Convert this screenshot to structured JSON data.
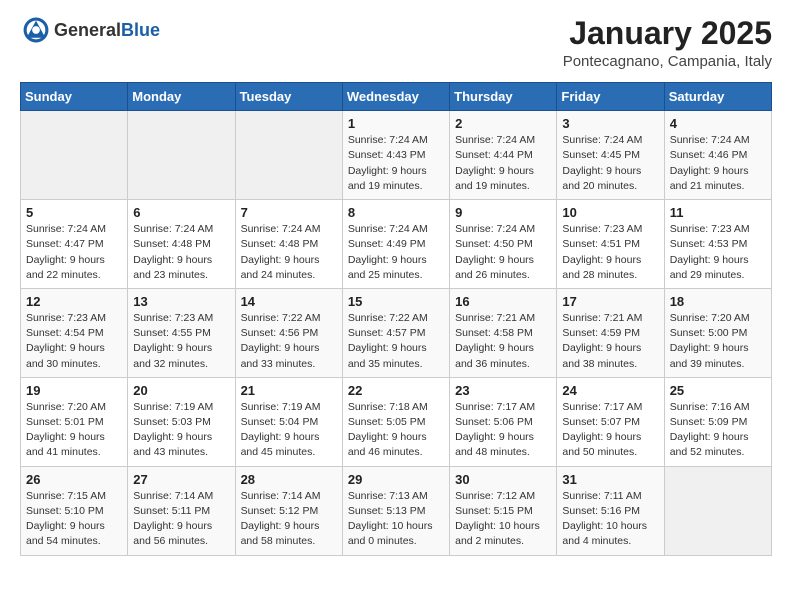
{
  "header": {
    "logo_general": "General",
    "logo_blue": "Blue",
    "month": "January 2025",
    "location": "Pontecagnano, Campania, Italy"
  },
  "weekdays": [
    "Sunday",
    "Monday",
    "Tuesday",
    "Wednesday",
    "Thursday",
    "Friday",
    "Saturday"
  ],
  "weeks": [
    [
      {
        "day": "",
        "sunrise": "",
        "sunset": "",
        "daylight": ""
      },
      {
        "day": "",
        "sunrise": "",
        "sunset": "",
        "daylight": ""
      },
      {
        "day": "",
        "sunrise": "",
        "sunset": "",
        "daylight": ""
      },
      {
        "day": "1",
        "sunrise": "Sunrise: 7:24 AM",
        "sunset": "Sunset: 4:43 PM",
        "daylight": "Daylight: 9 hours and 19 minutes."
      },
      {
        "day": "2",
        "sunrise": "Sunrise: 7:24 AM",
        "sunset": "Sunset: 4:44 PM",
        "daylight": "Daylight: 9 hours and 19 minutes."
      },
      {
        "day": "3",
        "sunrise": "Sunrise: 7:24 AM",
        "sunset": "Sunset: 4:45 PM",
        "daylight": "Daylight: 9 hours and 20 minutes."
      },
      {
        "day": "4",
        "sunrise": "Sunrise: 7:24 AM",
        "sunset": "Sunset: 4:46 PM",
        "daylight": "Daylight: 9 hours and 21 minutes."
      }
    ],
    [
      {
        "day": "5",
        "sunrise": "Sunrise: 7:24 AM",
        "sunset": "Sunset: 4:47 PM",
        "daylight": "Daylight: 9 hours and 22 minutes."
      },
      {
        "day": "6",
        "sunrise": "Sunrise: 7:24 AM",
        "sunset": "Sunset: 4:48 PM",
        "daylight": "Daylight: 9 hours and 23 minutes."
      },
      {
        "day": "7",
        "sunrise": "Sunrise: 7:24 AM",
        "sunset": "Sunset: 4:48 PM",
        "daylight": "Daylight: 9 hours and 24 minutes."
      },
      {
        "day": "8",
        "sunrise": "Sunrise: 7:24 AM",
        "sunset": "Sunset: 4:49 PM",
        "daylight": "Daylight: 9 hours and 25 minutes."
      },
      {
        "day": "9",
        "sunrise": "Sunrise: 7:24 AM",
        "sunset": "Sunset: 4:50 PM",
        "daylight": "Daylight: 9 hours and 26 minutes."
      },
      {
        "day": "10",
        "sunrise": "Sunrise: 7:23 AM",
        "sunset": "Sunset: 4:51 PM",
        "daylight": "Daylight: 9 hours and 28 minutes."
      },
      {
        "day": "11",
        "sunrise": "Sunrise: 7:23 AM",
        "sunset": "Sunset: 4:53 PM",
        "daylight": "Daylight: 9 hours and 29 minutes."
      }
    ],
    [
      {
        "day": "12",
        "sunrise": "Sunrise: 7:23 AM",
        "sunset": "Sunset: 4:54 PM",
        "daylight": "Daylight: 9 hours and 30 minutes."
      },
      {
        "day": "13",
        "sunrise": "Sunrise: 7:23 AM",
        "sunset": "Sunset: 4:55 PM",
        "daylight": "Daylight: 9 hours and 32 minutes."
      },
      {
        "day": "14",
        "sunrise": "Sunrise: 7:22 AM",
        "sunset": "Sunset: 4:56 PM",
        "daylight": "Daylight: 9 hours and 33 minutes."
      },
      {
        "day": "15",
        "sunrise": "Sunrise: 7:22 AM",
        "sunset": "Sunset: 4:57 PM",
        "daylight": "Daylight: 9 hours and 35 minutes."
      },
      {
        "day": "16",
        "sunrise": "Sunrise: 7:21 AM",
        "sunset": "Sunset: 4:58 PM",
        "daylight": "Daylight: 9 hours and 36 minutes."
      },
      {
        "day": "17",
        "sunrise": "Sunrise: 7:21 AM",
        "sunset": "Sunset: 4:59 PM",
        "daylight": "Daylight: 9 hours and 38 minutes."
      },
      {
        "day": "18",
        "sunrise": "Sunrise: 7:20 AM",
        "sunset": "Sunset: 5:00 PM",
        "daylight": "Daylight: 9 hours and 39 minutes."
      }
    ],
    [
      {
        "day": "19",
        "sunrise": "Sunrise: 7:20 AM",
        "sunset": "Sunset: 5:01 PM",
        "daylight": "Daylight: 9 hours and 41 minutes."
      },
      {
        "day": "20",
        "sunrise": "Sunrise: 7:19 AM",
        "sunset": "Sunset: 5:03 PM",
        "daylight": "Daylight: 9 hours and 43 minutes."
      },
      {
        "day": "21",
        "sunrise": "Sunrise: 7:19 AM",
        "sunset": "Sunset: 5:04 PM",
        "daylight": "Daylight: 9 hours and 45 minutes."
      },
      {
        "day": "22",
        "sunrise": "Sunrise: 7:18 AM",
        "sunset": "Sunset: 5:05 PM",
        "daylight": "Daylight: 9 hours and 46 minutes."
      },
      {
        "day": "23",
        "sunrise": "Sunrise: 7:17 AM",
        "sunset": "Sunset: 5:06 PM",
        "daylight": "Daylight: 9 hours and 48 minutes."
      },
      {
        "day": "24",
        "sunrise": "Sunrise: 7:17 AM",
        "sunset": "Sunset: 5:07 PM",
        "daylight": "Daylight: 9 hours and 50 minutes."
      },
      {
        "day": "25",
        "sunrise": "Sunrise: 7:16 AM",
        "sunset": "Sunset: 5:09 PM",
        "daylight": "Daylight: 9 hours and 52 minutes."
      }
    ],
    [
      {
        "day": "26",
        "sunrise": "Sunrise: 7:15 AM",
        "sunset": "Sunset: 5:10 PM",
        "daylight": "Daylight: 9 hours and 54 minutes."
      },
      {
        "day": "27",
        "sunrise": "Sunrise: 7:14 AM",
        "sunset": "Sunset: 5:11 PM",
        "daylight": "Daylight: 9 hours and 56 minutes."
      },
      {
        "day": "28",
        "sunrise": "Sunrise: 7:14 AM",
        "sunset": "Sunset: 5:12 PM",
        "daylight": "Daylight: 9 hours and 58 minutes."
      },
      {
        "day": "29",
        "sunrise": "Sunrise: 7:13 AM",
        "sunset": "Sunset: 5:13 PM",
        "daylight": "Daylight: 10 hours and 0 minutes."
      },
      {
        "day": "30",
        "sunrise": "Sunrise: 7:12 AM",
        "sunset": "Sunset: 5:15 PM",
        "daylight": "Daylight: 10 hours and 2 minutes."
      },
      {
        "day": "31",
        "sunrise": "Sunrise: 7:11 AM",
        "sunset": "Sunset: 5:16 PM",
        "daylight": "Daylight: 10 hours and 4 minutes."
      },
      {
        "day": "",
        "sunrise": "",
        "sunset": "",
        "daylight": ""
      }
    ]
  ]
}
